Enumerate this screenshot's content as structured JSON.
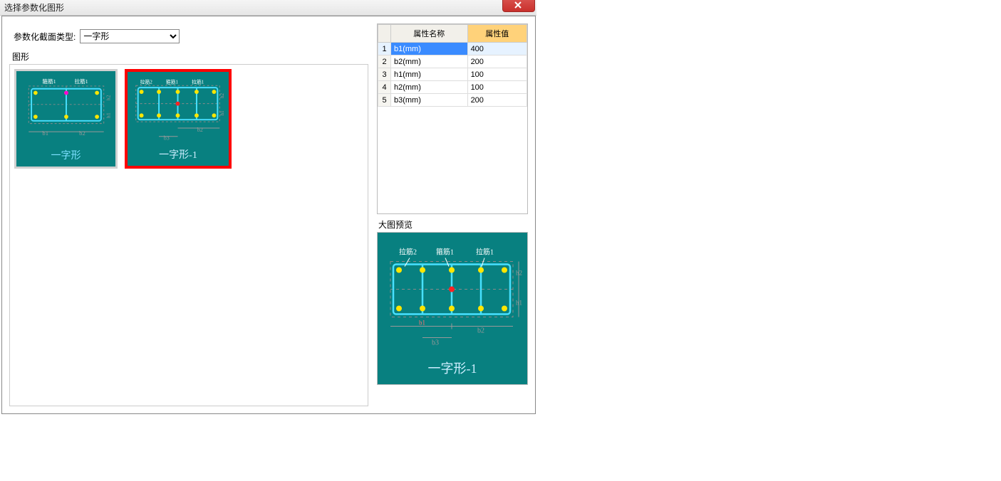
{
  "window": {
    "title": "选择参数化图形",
    "close_tooltip": "关闭"
  },
  "type": {
    "label": "参数化截面类型:",
    "value": "一字形",
    "options": [
      "一字形"
    ]
  },
  "shapes": {
    "group_label": "图形",
    "items": [
      {
        "label": "一字形",
        "anno": {
          "l1": "箍筋1",
          "l2": "拉筋1",
          "b1": "b1",
          "b2": "b2",
          "h1": "h1",
          "h2": "h2"
        }
      },
      {
        "label": "一字形-1",
        "anno": {
          "l1": "拉筋2",
          "l2": "箍筋1",
          "l3": "拉筋1",
          "b2": "b2",
          "b3": "b3",
          "h1": "h1",
          "h2": "h2"
        }
      }
    ],
    "selected": 1
  },
  "properties": {
    "header_name": "属性名称",
    "header_value": "属性值",
    "rows": [
      {
        "idx": "1",
        "name": "b1(mm)",
        "value": "400"
      },
      {
        "idx": "2",
        "name": "b2(mm)",
        "value": "200"
      },
      {
        "idx": "3",
        "name": "h1(mm)",
        "value": "100"
      },
      {
        "idx": "4",
        "name": "h2(mm)",
        "value": "100"
      },
      {
        "idx": "5",
        "name": "b3(mm)",
        "value": "200"
      }
    ],
    "selected_row": 0
  },
  "preview": {
    "label": "大图预览",
    "caption": "一字形-1",
    "anno": {
      "l1": "拉筋2",
      "l2": "箍筋1",
      "l3": "拉筋1",
      "b1": "b1",
      "b2": "b2",
      "b3": "b3",
      "h1": "h1",
      "h2": "h2"
    }
  }
}
